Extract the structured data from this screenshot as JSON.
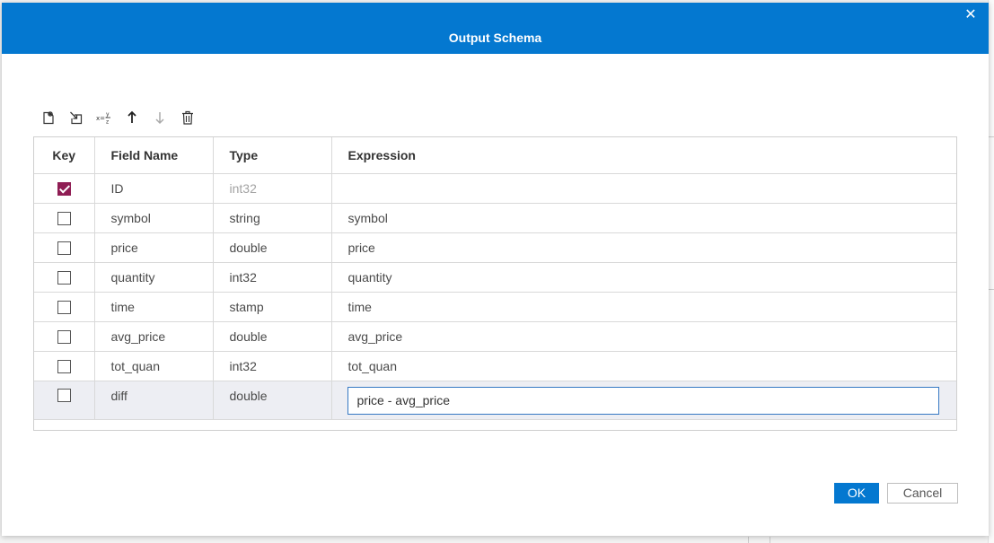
{
  "dialog": {
    "title": "Output Schema",
    "close_icon": "close-icon"
  },
  "toolbar": {
    "tools": [
      {
        "name": "new-field-icon"
      },
      {
        "name": "insert-field-icon"
      },
      {
        "name": "expression-icon",
        "label": "x=y/z"
      },
      {
        "name": "move-up-icon"
      },
      {
        "name": "move-down-icon"
      },
      {
        "name": "delete-icon"
      }
    ]
  },
  "grid": {
    "headers": {
      "key": "Key",
      "field_name": "Field Name",
      "type": "Type",
      "expression": "Expression"
    },
    "rows": [
      {
        "key": true,
        "field_name": "ID",
        "type": "int32",
        "expression": "",
        "type_muted": true
      },
      {
        "key": false,
        "field_name": "symbol",
        "type": "string",
        "expression": "symbol"
      },
      {
        "key": false,
        "field_name": "price",
        "type": "double",
        "expression": "price"
      },
      {
        "key": false,
        "field_name": "quantity",
        "type": "int32",
        "expression": "quantity"
      },
      {
        "key": false,
        "field_name": "time",
        "type": "stamp",
        "expression": "time"
      },
      {
        "key": false,
        "field_name": "avg_price",
        "type": "double",
        "expression": "avg_price"
      },
      {
        "key": false,
        "field_name": "tot_quan",
        "type": "int32",
        "expression": "tot_quan"
      },
      {
        "key": false,
        "field_name": "diff",
        "type": "double",
        "expression": "price - avg_price",
        "editing": true
      }
    ]
  },
  "buttons": {
    "ok": "OK",
    "cancel": "Cancel"
  },
  "colors": {
    "titlebar": "#0478d0",
    "checkbox_checked": "#8f1d54",
    "selected_row": "#edeef3"
  }
}
